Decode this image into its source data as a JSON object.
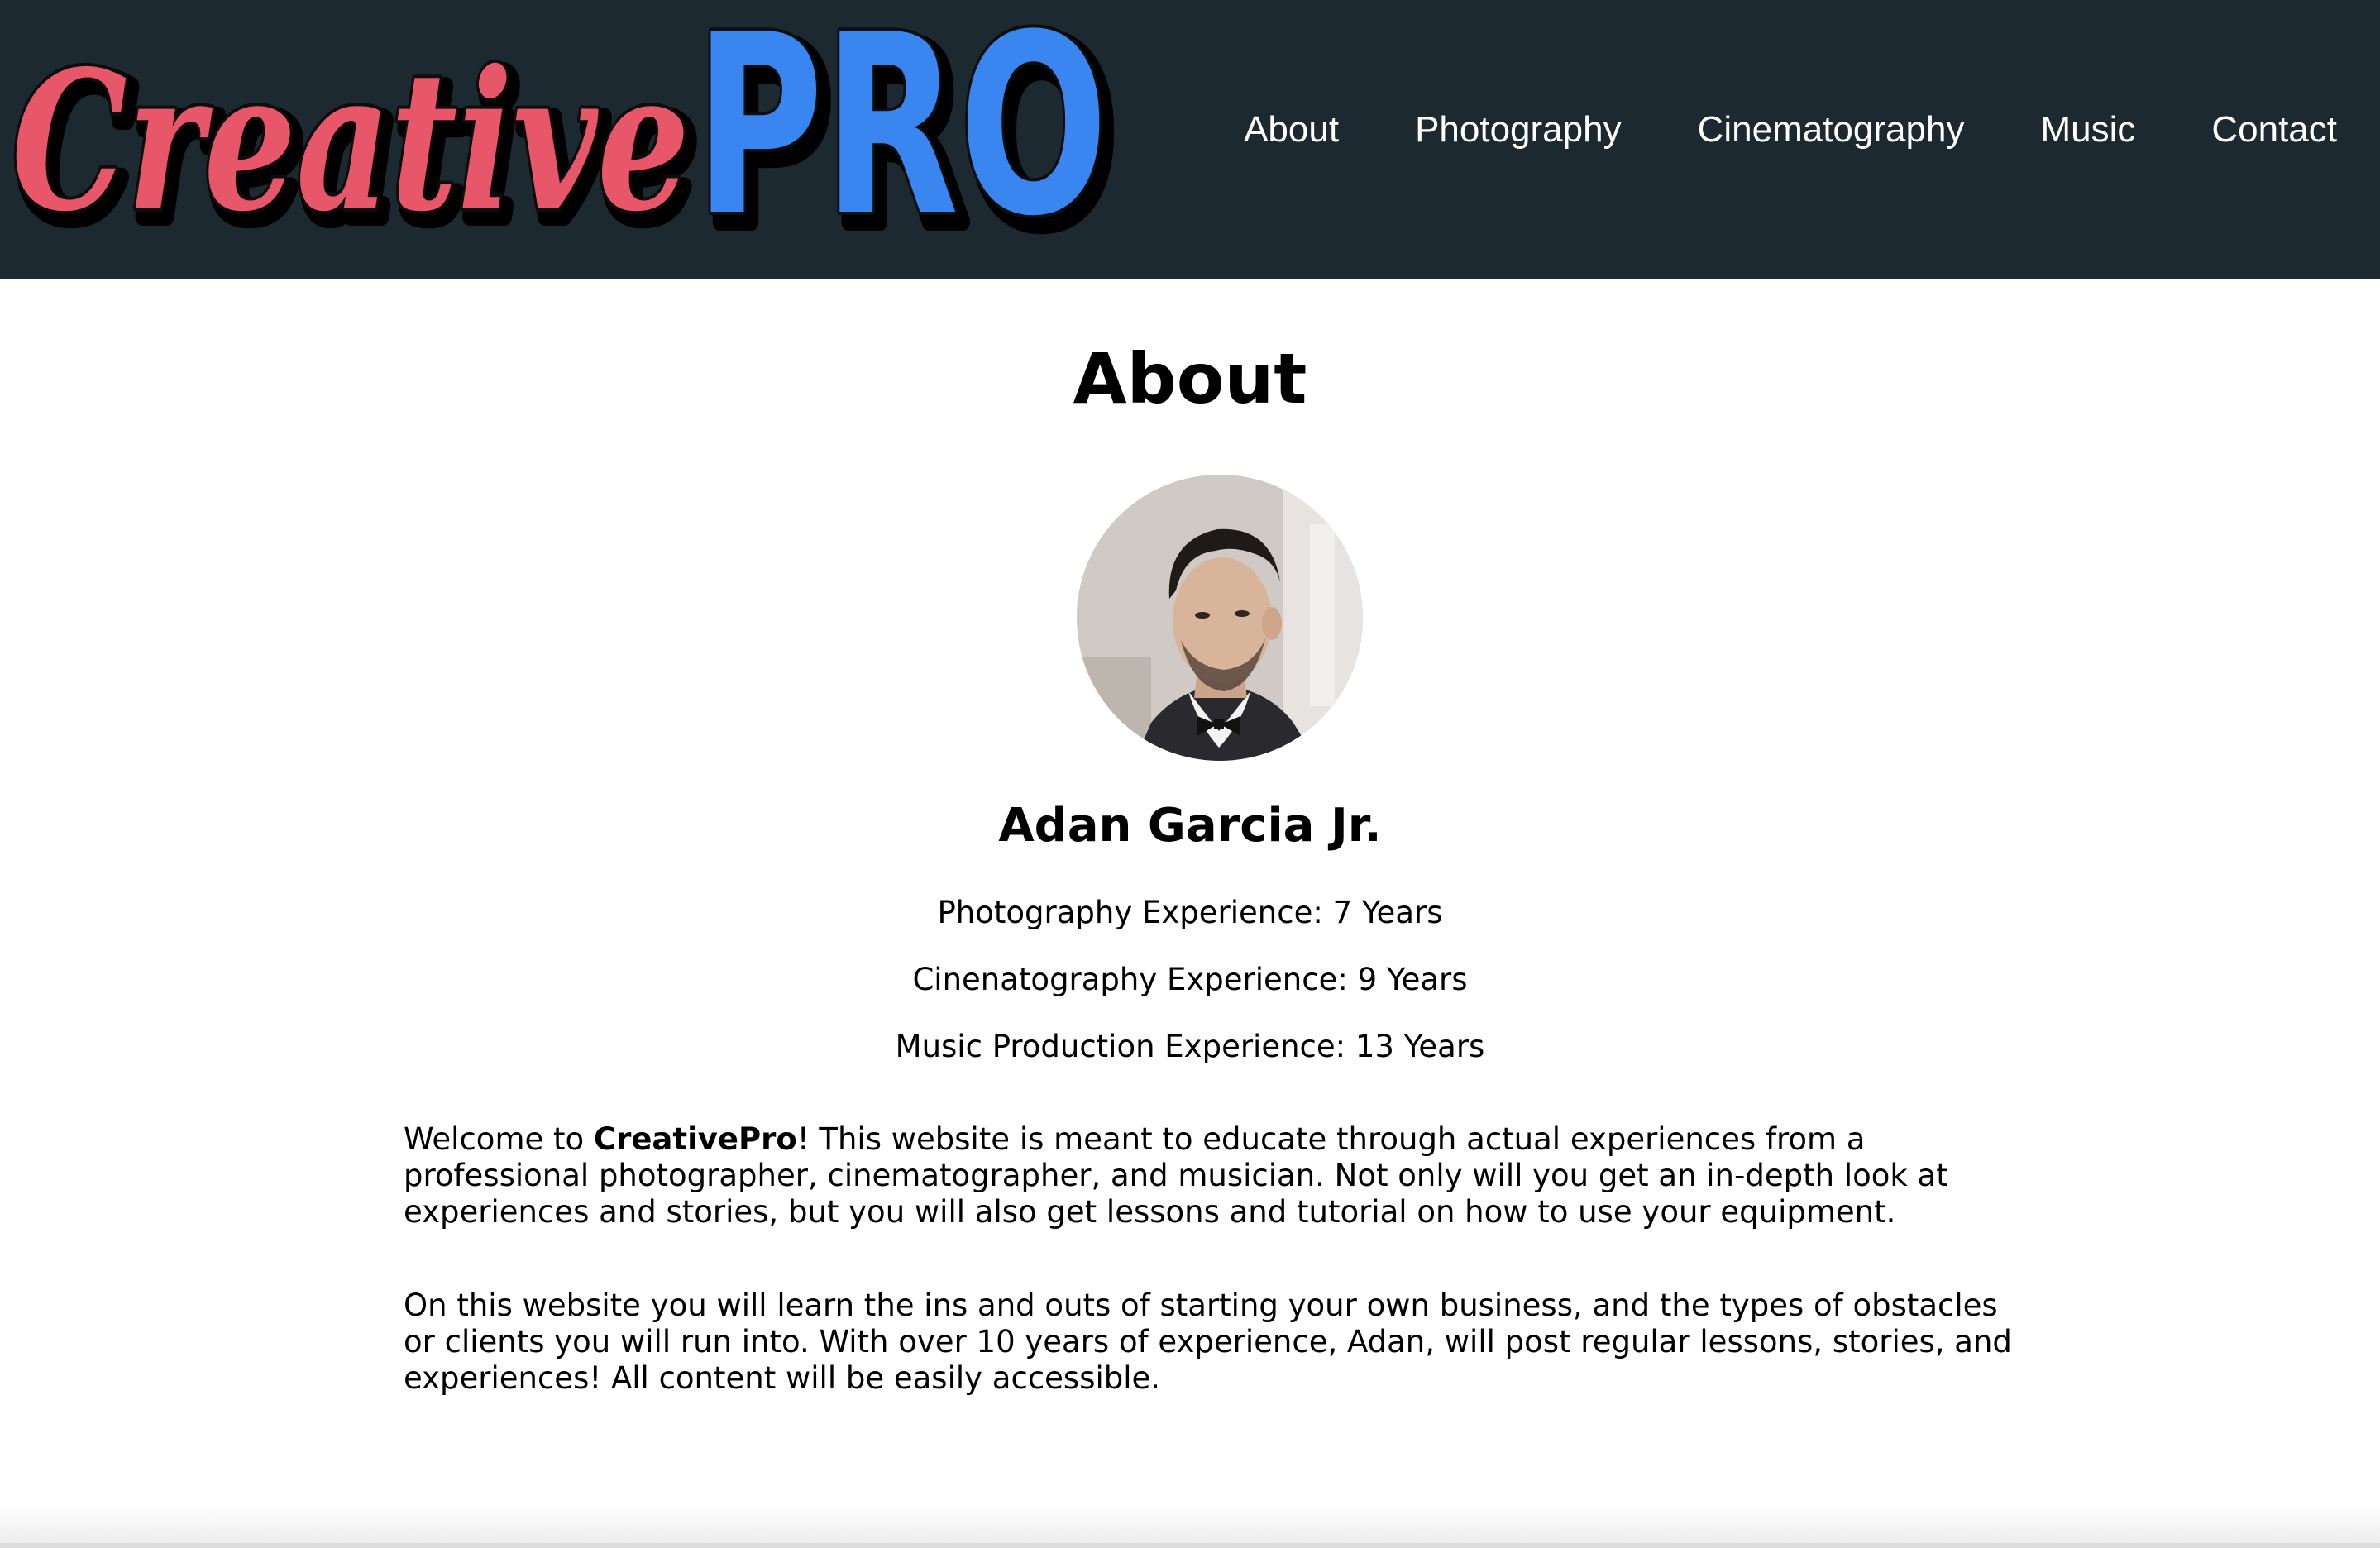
{
  "header": {
    "logo": {
      "part1": "Creative",
      "part2": "PRO",
      "color_part1": "#e8566a",
      "color_part2": "#3a86f0"
    },
    "background_color": "#1c2931",
    "nav": [
      {
        "label": "About"
      },
      {
        "label": "Photography"
      },
      {
        "label": "Cinematography"
      },
      {
        "label": "Music"
      },
      {
        "label": "Contact"
      }
    ]
  },
  "main": {
    "page_title": "About",
    "profile": {
      "avatar_icon": "profile-photo",
      "name": "Adan Garcia Jr.",
      "experience": [
        "Photography Experience: 7 Years",
        "Cinenatography Experience: 9 Years",
        "Music Production Experience: 13 Years"
      ]
    },
    "intro": {
      "welcome_prefix": "Welcome to ",
      "brand": "CreativePro",
      "welcome_rest": "! This website is meant to educate through actual experiences from a professional photographer, cinematographer, and musician. Not only will you get an in-depth look at experiences and stories, but you will also get lessons and tutorial on how to use your equipment.",
      "paragraph2": "On this website you will learn the ins and outs of starting your own business, and the types of obstacles or clients you will run into. With over 10 years of experience, Adan, will post regular lessons, stories, and experiences! All content will be easily accessible."
    }
  }
}
